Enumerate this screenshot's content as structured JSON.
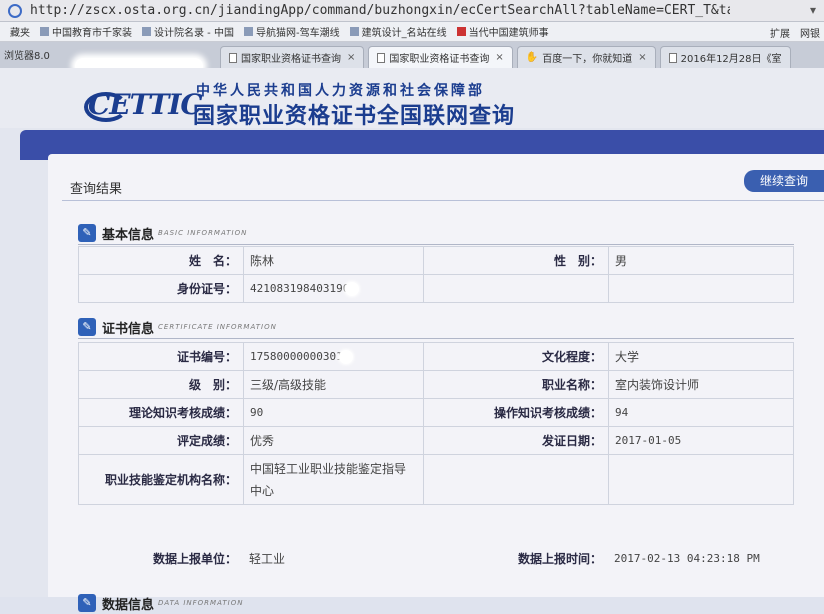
{
  "browser": {
    "url": "http://zscx.osta.org.cn/jiandingApp/command/buzhongxin/ecCertSearchAll?tableName=CERT_T&tableName",
    "bookmarks": [
      "藏夹",
      "中国教育市千家装",
      "设计院名录 - 中国",
      "导航猫网-驾车潮线",
      "建筑设计_名站在线",
      "当代中国建筑师事"
    ],
    "bookmarks_right": [
      "扩展",
      "网银"
    ],
    "first_tab": "浏览器8.0",
    "tabs": [
      {
        "label": "国家职业资格证书查询",
        "active": false
      },
      {
        "label": "国家职业资格证书查询",
        "active": true
      },
      {
        "label": "百度一下，你就知道",
        "active": false
      },
      {
        "label": "2016年12月28日《室",
        "active": false
      }
    ],
    "close_glyph": "×"
  },
  "header": {
    "logo": "CETTIC",
    "ministry": "中华人民共和国人力资源和社会保障部",
    "title": "国家职业资格证书全国联网查询"
  },
  "result": {
    "title": "查询结果",
    "continue_button": "继续查询"
  },
  "basic": {
    "name": "基本信息",
    "en": "BASIC INFORMATION",
    "name_label": "姓　名：",
    "name_value": "陈林",
    "gender_label": "性　别：",
    "gender_value": "男",
    "id_label": "身份证号：",
    "id_value": "421083198403190"
  },
  "cert": {
    "name": "证书信息",
    "en": "CERTIFICATE INFORMATION",
    "rows": [
      {
        "l1": "证书编号：",
        "v1": "17580000000301",
        "l2": "文化程度：",
        "v2": "大学"
      },
      {
        "l1": "级　别：",
        "v1": "三级/高级技能",
        "l2": "职业名称：",
        "v2": "室内装饰设计师"
      },
      {
        "l1": "理论知识考核成绩：",
        "v1": "90",
        "l2": "操作知识考核成绩：",
        "v2": "94"
      },
      {
        "l1": "评定成绩：",
        "v1": "优秀",
        "l2": "发证日期：",
        "v2": "2017-01-05"
      },
      {
        "l1": "职业技能鉴定机构名称：",
        "v1": "中国轻工业职业技能鉴定指导中心",
        "l2": "",
        "v2": ""
      }
    ]
  },
  "data_info": {
    "name": "数据信息",
    "en": "DATA INFORMATION",
    "unit_label": "数据上报单位：",
    "unit_value": "轻工业",
    "time_label": "数据上报时间：",
    "time_value": "2017-02-13 04:23:18 PM"
  },
  "colors": {
    "brand": "#1b3d8f",
    "band": "#3a4ea8",
    "button": "#3a5fb0"
  }
}
